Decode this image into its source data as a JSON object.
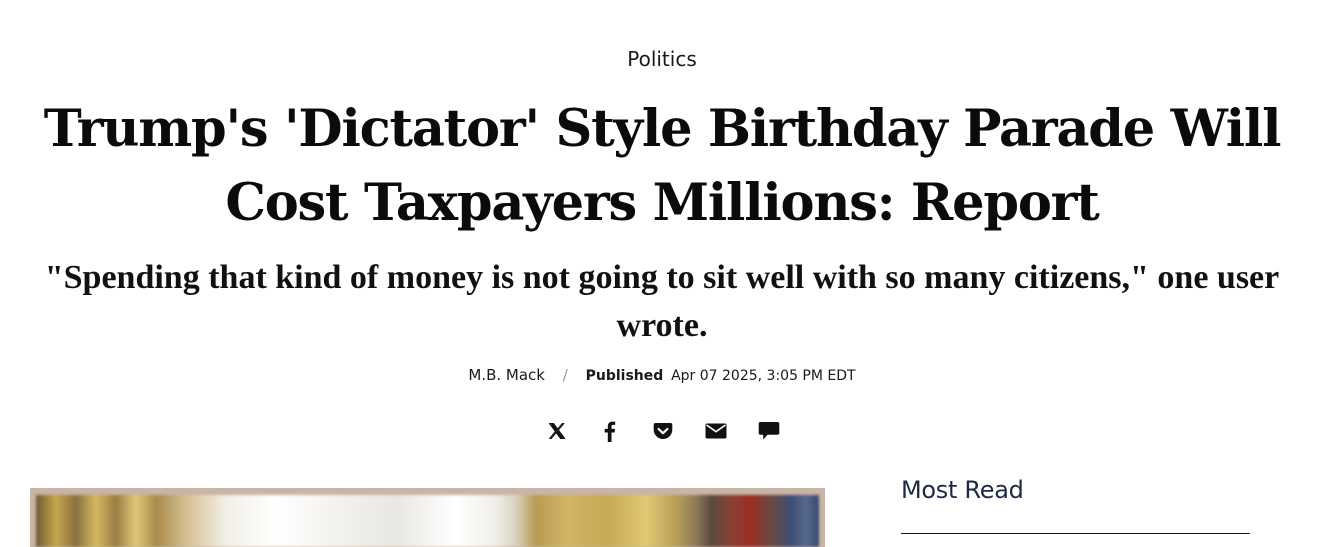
{
  "article": {
    "category": "Politics",
    "headline": "Trump's 'Dictator' Style Birthday Parade Will Cost Taxpayers Millions: Report",
    "dek": "\"Spending that kind of money is not going to sit well with so many citizens,\" one user wrote.",
    "byline": {
      "author": "M.B. Mack",
      "separator": "/",
      "published_label": "Published",
      "published_date": "Apr 07 2025, 3:05 PM EDT"
    }
  },
  "share": {
    "icons": [
      "x-icon",
      "facebook-icon",
      "pocket-icon",
      "email-icon",
      "comment-icon"
    ]
  },
  "sidebar": {
    "title": "Most Read"
  },
  "colors": {
    "text": "#111111",
    "sidebar_title": "#1c2a44",
    "separator": "#9a9a9a"
  }
}
